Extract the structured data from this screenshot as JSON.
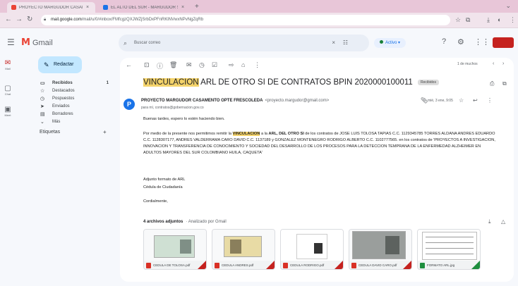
{
  "browser": {
    "tabs": [
      {
        "label": "PROYECTO MARGUDOR CASAMENTO OPTE FRESCOLEDA"
      },
      {
        "label": "EL ALTO DEL SUR - MARGUDOR S.A."
      }
    ],
    "url_host": "mail.google.com",
    "url_path": "/mail/u/0/#inbox/FMfcgzQXJWZjSrbDxPFnRKlNVwxNPvNgZqRb"
  },
  "header": {
    "app_name": "Gmail",
    "search_placeholder": "Buscar correo",
    "status_label": "Activo"
  },
  "rail": {
    "items": [
      {
        "label": "Mail"
      },
      {
        "label": "Chat"
      },
      {
        "label": "Meet"
      }
    ]
  },
  "sidebar": {
    "compose_label": "Redactar",
    "folders": [
      {
        "label": "Recibidos",
        "count": "1"
      },
      {
        "label": "Destacados",
        "count": ""
      },
      {
        "label": "Pospuestos",
        "count": ""
      },
      {
        "label": "Enviados",
        "count": ""
      },
      {
        "label": "Borradores",
        "count": ""
      },
      {
        "label": "Más",
        "count": ""
      }
    ],
    "labels_title": "Etiquetas"
  },
  "toolbar": {
    "pager": "1 de muchos"
  },
  "email": {
    "subject_highlight": "VINCULACION",
    "subject_rest": " ARL DE OTRO SI DE CONTRATOS BPIN 2020000100011",
    "subject_label": "Recibidos",
    "sender_name": "PROYECTO MARGUDOR CASAMENTO OPTE FRESCOLEDA",
    "sender_email": "<proyecto.margudor@gmail.com>",
    "to_line": "para mí, contratos@gobernacion.gov.co",
    "date": "mié, 3 ene, 9:05",
    "greeting": "Buenas tardes, espero lo estén haciendo bien.",
    "p1_a": "Por medio de la presente nos permitimos remitir la ",
    "p1_hl": "VINCULACION",
    "p1_b": " a la ",
    "p1_bold": "ARL, DEL OTRO SI",
    "p1_c": " de los contratos de JOSE LUIS TOLOSA TAPIAS C.C. 1129345785 TORRES ALDANA ANDRES EDUARDO C.C. 1128307177, ANDRES VALDERRAMA CARO DAVID C.C. 1137189 y GONZALEZ MONTENEGRO RODRIGO ALBERTO C.C. 1102777565. en los contratos de 'PROYECTOS A INVESTIGACION, INNOVACION Y TRANSFERENCIA DE CONOCIMIENTO Y SOCIEDAD DEL DESARROLLO DE LOS PROCESOS PARA LA DETECCION TEMPRANA DE LA ENFERMEDAD ALZHEIMER EN ADULTOS MAYORES DEL SUR COLOMBIANO HUILA, CAQUETA'",
    "sign1": "Adjunto formato de ARL",
    "sign2": "Cédula de Ciudadanía",
    "sign3": "Cordialmente,",
    "attachments_title": "4 archivos adjuntos",
    "attachments_scan": "· Analizado por Gmail",
    "attachments": [
      {
        "name": "CEDULA DE TOLOSA.pdf"
      },
      {
        "name": "CEDULA ANDRES.pdf"
      },
      {
        "name": "CEDULA RODRIGO.pdf"
      },
      {
        "name": "CEDULA DAVID CARO.pdf"
      },
      {
        "name": "FORMATO ARL.jpg"
      }
    ]
  },
  "colors": {
    "accent": "#c2e7ff",
    "highlight": "#f4d36a",
    "gmail_red": "#ea4335",
    "pdf_red": "#d93025"
  }
}
